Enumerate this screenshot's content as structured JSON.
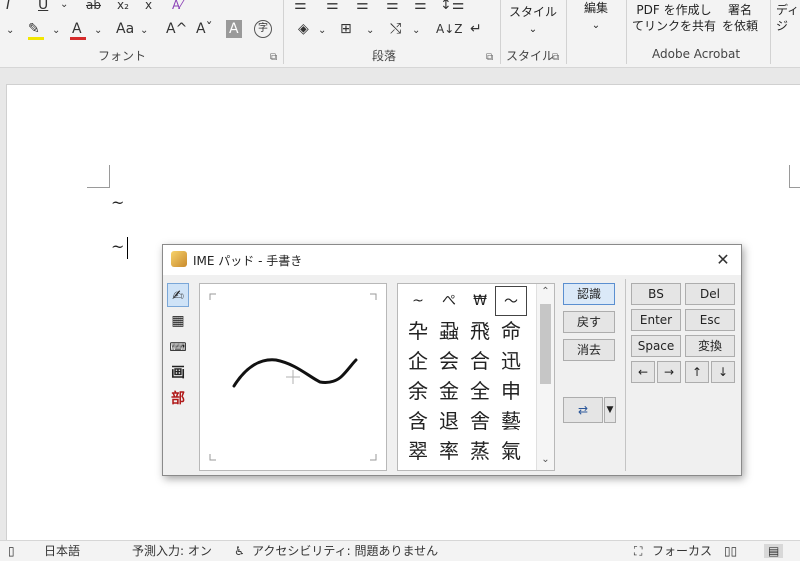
{
  "ribbon": {
    "groups": [
      {
        "label": "フォント"
      },
      {
        "label": "段落"
      },
      {
        "label": "スタイル"
      },
      {
        "label": "Adobe Acrobat"
      }
    ],
    "styles_label": "スタイル",
    "edit_label": "編集",
    "pdf_label_line1": "PDF を作成し",
    "pdf_label_line2": "てリンクを共有",
    "sign_label_line1": "署名",
    "sign_label_line2": "を依頼",
    "dict_label": "ディ",
    "dict_label2": "ジ",
    "font_size_label": "Aa",
    "increase_font": "A",
    "decrease_font": "A"
  },
  "document": {
    "lines": [
      "~",
      "~"
    ]
  },
  "ime_pad": {
    "title": "IME パッド - 手書き",
    "side_icons": [
      "handwriting-icon",
      "char-list-icon",
      "soft-keyboard-icon",
      "stroke-count-icon",
      "radical-icon"
    ],
    "side_labels": [
      "",
      "",
      "",
      "画",
      "部"
    ],
    "candidates": [
      [
        "~",
        "ぺ",
        "₩",
        "〜"
      ],
      [
        "卆",
        "蝨",
        "飛",
        "命"
      ],
      [
        "企",
        "会",
        "合",
        "迅"
      ],
      [
        "余",
        "金",
        "全",
        "申"
      ],
      [
        "含",
        "退",
        "舎",
        "藝"
      ],
      [
        "翠",
        "率",
        "蒸",
        "氣"
      ]
    ],
    "buttons": {
      "recognize": "認識",
      "undo": "戻す",
      "clear": "消去"
    },
    "keys": [
      [
        "BS",
        "Del"
      ],
      [
        "Enter",
        "Esc"
      ],
      [
        "Space",
        "変換"
      ],
      [
        "←",
        "→",
        "↑",
        "↓"
      ]
    ]
  },
  "status": {
    "language": "日本語",
    "prediction": "予測入力: オン",
    "accessibility": "アクセシビリティ: 問題ありません",
    "focus": "フォーカス"
  },
  "colors": {
    "highlight": "#f2e600",
    "font_color": "#d62b2b",
    "accent": "#2b579a"
  }
}
